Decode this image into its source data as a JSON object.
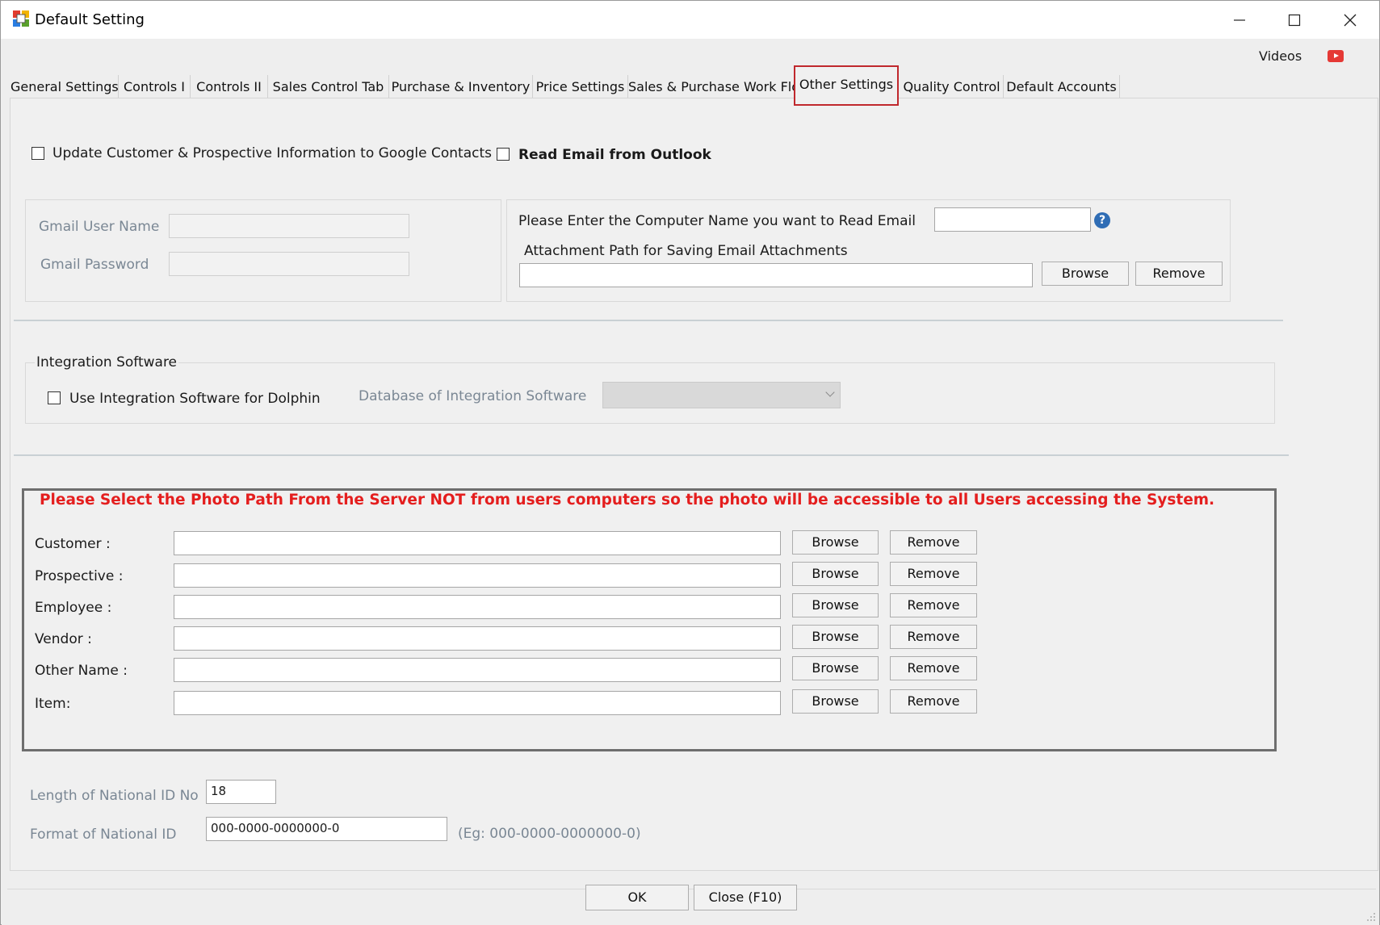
{
  "window": {
    "title": "Default Setting",
    "videos_label": "Videos"
  },
  "tabs": [
    {
      "label": "General Settings"
    },
    {
      "label": "Controls I"
    },
    {
      "label": "Controls II"
    },
    {
      "label": "Sales Control Tab"
    },
    {
      "label": "Purchase & Inventory"
    },
    {
      "label": "Price Settings"
    },
    {
      "label": "Sales & Purchase Work Flow"
    },
    {
      "label": "Other Settings"
    },
    {
      "label": "Quality Control"
    },
    {
      "label": "Default Accounts"
    }
  ],
  "active_tab": "Other Settings",
  "google": {
    "checkbox_label": "Update Customer & Prospective Information to Google Contacts",
    "checked": false,
    "user_name_label": "Gmail User Name",
    "password_label": "Gmail Password"
  },
  "outlook": {
    "checkbox_label": "Read Email from Outlook",
    "checked": false,
    "computer_name_label": "Please Enter the Computer Name you want to Read Email",
    "attachment_label": "Attachment Path for Saving Email Attachments",
    "browse_label": "Browse",
    "remove_label": "Remove"
  },
  "integration": {
    "group_title": "Integration Software",
    "checkbox_label": "Use Integration Software for Dolphin",
    "checked": false,
    "database_label": "Database of Integration Software"
  },
  "photo_paths": {
    "warning": "Please Select the Photo Path From the Server NOT from users computers so the photo will be accessible to all Users accessing the System.",
    "rows": [
      {
        "label": "Customer :",
        "browse": "Browse",
        "remove": "Remove"
      },
      {
        "label": "Prospective :",
        "browse": "Browse",
        "remove": "Remove"
      },
      {
        "label": "Employee :",
        "browse": "Browse",
        "remove": "Remove"
      },
      {
        "label": "Vendor :",
        "browse": "Browse",
        "remove": "Remove"
      },
      {
        "label": "Other Name :",
        "browse": "Browse",
        "remove": "Remove"
      },
      {
        "label": "Item:",
        "browse": "Browse",
        "remove": "Remove"
      }
    ]
  },
  "national_id": {
    "length_label": "Length of National ID No",
    "length_value": "18",
    "format_label": "Format of National ID",
    "format_value": "000-0000-0000000-0",
    "format_example": "(Eg: 000-0000-0000000-0)"
  },
  "footer": {
    "ok_label": "OK",
    "close_label": "Close (F10)"
  },
  "colors": {
    "active_tab_border": "#c0282d",
    "warning_text": "#e41e1e",
    "help_icon": "#2f6db5",
    "video_icon": "#e53935"
  }
}
